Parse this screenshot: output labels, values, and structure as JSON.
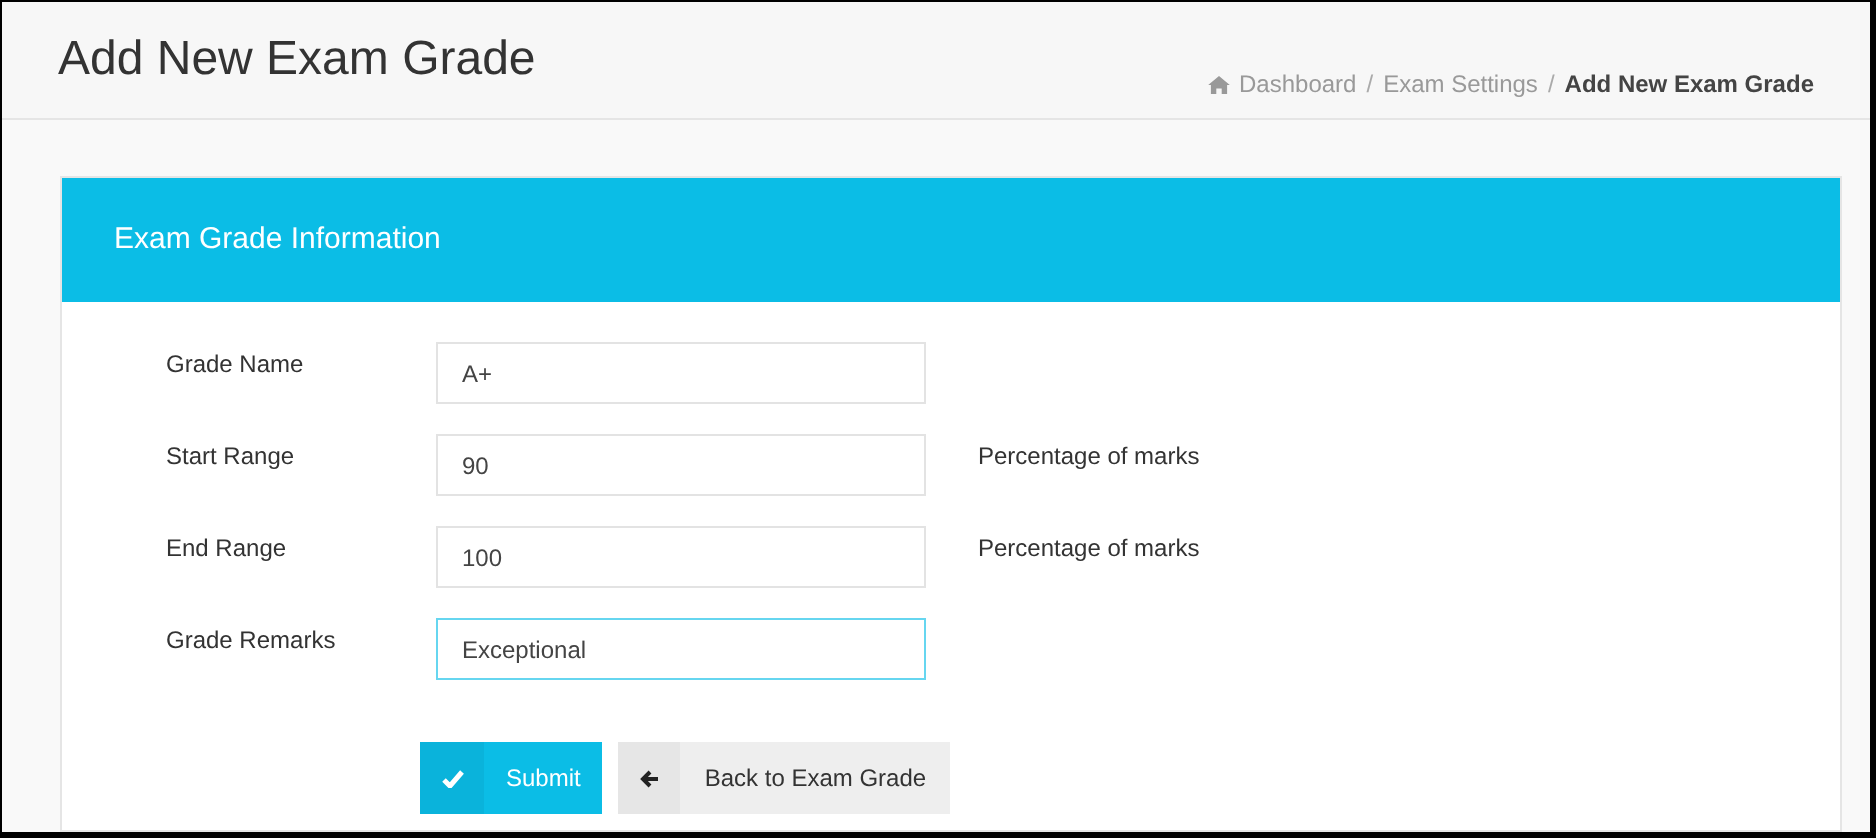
{
  "page_title": "Add New Exam Grade",
  "breadcrumb_separator": "/",
  "breadcrumb": [
    {
      "label": "Dashboard",
      "current": false
    },
    {
      "label": "Exam Settings",
      "current": false
    },
    {
      "label": "Add New Exam Grade",
      "current": true
    }
  ],
  "panel": {
    "title": "Exam Grade Information",
    "fields": [
      {
        "label": "Grade Name",
        "value": "A+",
        "focused": false
      },
      {
        "label": "Start Range",
        "value": "90",
        "hint": "Percentage of marks",
        "focused": false
      },
      {
        "label": "End Range",
        "value": "100",
        "hint": "Percentage of marks",
        "focused": false
      },
      {
        "label": "Grade Remarks",
        "value": "Exceptional",
        "focused": true
      }
    ],
    "buttons": [
      {
        "kind": "submit",
        "label": "Submit"
      },
      {
        "kind": "back",
        "label": "Back to Exam Grade"
      }
    ]
  }
}
